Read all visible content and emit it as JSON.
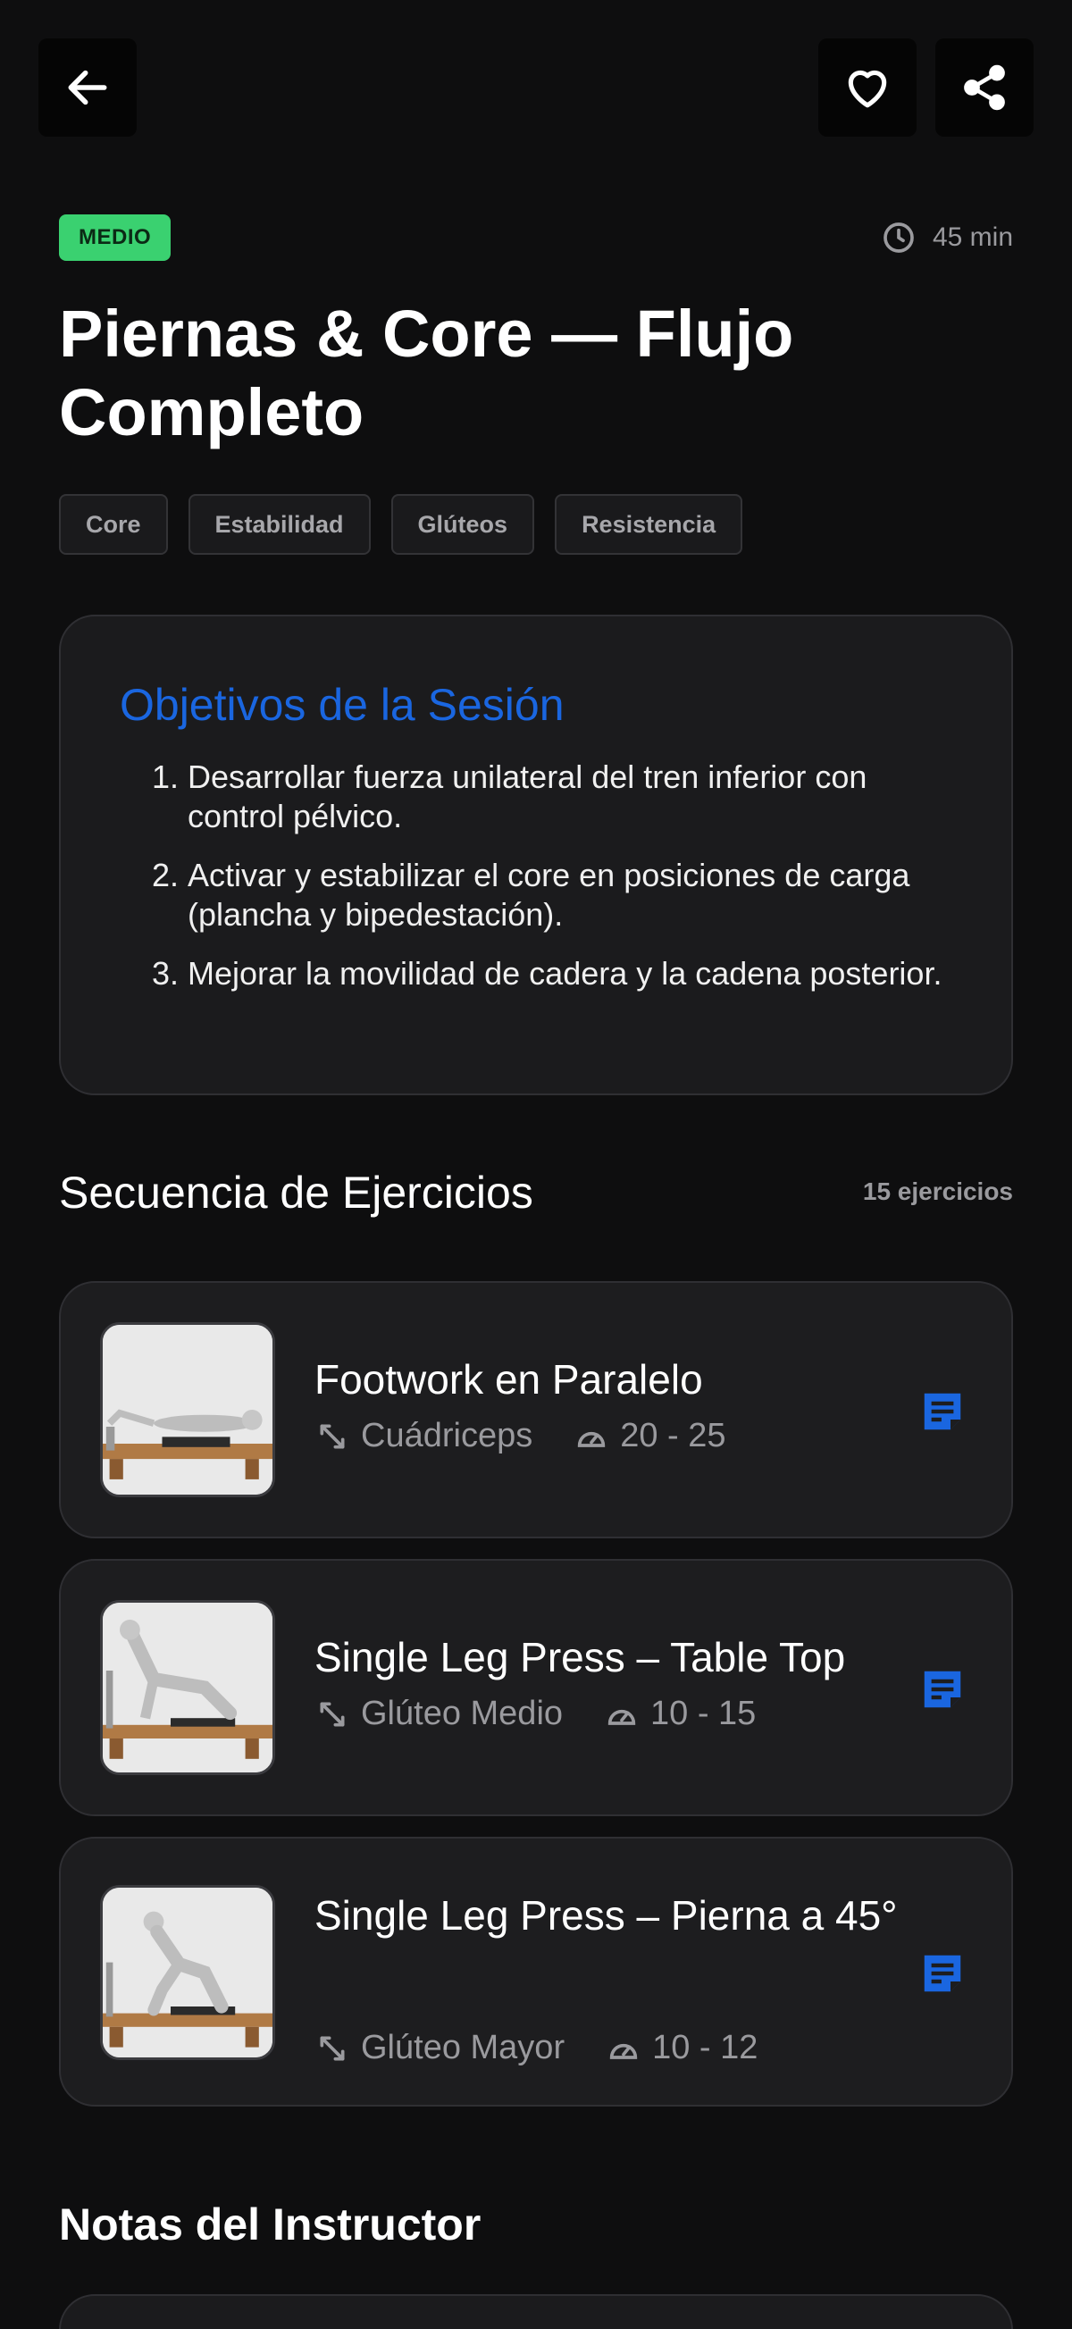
{
  "header": {
    "back_icon": "arrow-left-icon",
    "favorite_icon": "heart-icon",
    "share_icon": "share-icon"
  },
  "session": {
    "level": "MEDIO",
    "level_color": "#3ad170",
    "duration": "45 min",
    "title": "Piernas & Core — Flujo Completo",
    "tags": [
      "Core",
      "Estabilidad",
      "Glúteos",
      "Resistencia"
    ]
  },
  "objectives": {
    "title": "Objetivos de la Sesión",
    "accent_color": "#1a66e0",
    "items": [
      {
        "num": "1.",
        "text": "Desarrollar fuerza unilateral del tren inferior con control pélvico."
      },
      {
        "num": "2.",
        "text": "Activar y estabilizar el core en posiciones de carga (plancha y bipedestación)."
      },
      {
        "num": "3.",
        "text": "Mejorar la movilidad de cadera y la cadena posterior."
      }
    ]
  },
  "sequence": {
    "title": "Secuencia de Ejercicios",
    "count": "15 ejercicios",
    "exercises": [
      {
        "name": "Footwork en Paralelo",
        "muscle": "Cuádriceps",
        "reps": "20 - 25"
      },
      {
        "name": "Single Leg Press – Table Top",
        "muscle": "Glúteo Medio",
        "reps": "10 - 15"
      },
      {
        "name": "Single Leg Press – Pierna a 45°",
        "muscle": "Glúteo Mayor",
        "reps": "10 - 12"
      }
    ]
  },
  "notes": {
    "title": "Notas del Instructor"
  }
}
